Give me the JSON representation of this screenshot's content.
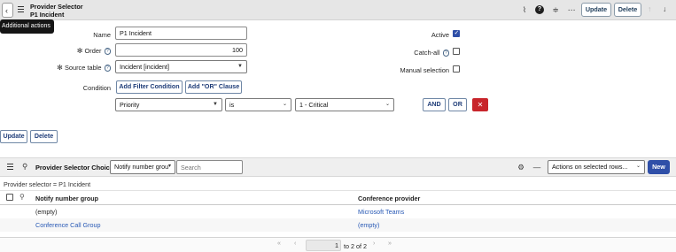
{
  "header": {
    "title_line1": "Provider Selector",
    "title_line2": "P1 Incident",
    "update_label": "Update",
    "delete_label": "Delete",
    "icons": [
      "paperclip-icon",
      "help-icon",
      "settings-icon",
      "more-icon",
      "up-arrow-icon",
      "down-arrow-icon"
    ]
  },
  "tooltip": "Additional actions",
  "form": {
    "name_label": "Name",
    "name_value": "P1 Incident",
    "order_label": "Order",
    "order_value": "100",
    "source_table_label": "Source table",
    "source_table_value": "Incident [incident]",
    "condition_label": "Condition",
    "add_filter_label": "Add Filter Condition",
    "add_or_label": "Add \"OR\" Clause",
    "condition_field": "Priority",
    "condition_operator": "is",
    "condition_value": "1 - Critical",
    "and_label": "AND",
    "or_label": "OR",
    "remove_symbol": "✕",
    "active_label": "Active",
    "active_checked": true,
    "catchall_label": "Catch-all",
    "catchall_checked": false,
    "manual_label": "Manual selection",
    "manual_checked": false
  },
  "footer_buttons": {
    "update_label": "Update",
    "delete_label": "Delete"
  },
  "related_list": {
    "title": "Provider Selector Choices",
    "search_field_select": "Notify number grou",
    "search_placeholder": "Search",
    "actions_select": "Actions on selected rows...",
    "new_label": "New",
    "filter_text": "Provider selector = P1 Incident",
    "columns": [
      "Notify number group",
      "Conference provider"
    ],
    "rows": [
      {
        "group": "(empty)",
        "provider": "Microsoft Teams"
      },
      {
        "group": "Conference Call Group",
        "provider": "(empty)"
      }
    ],
    "pager_page": "1",
    "pager_text": "to 2 of 2"
  },
  "colors": {
    "accent": "#2f4fa8",
    "danger": "#c8252b",
    "link": "#2859b5"
  }
}
